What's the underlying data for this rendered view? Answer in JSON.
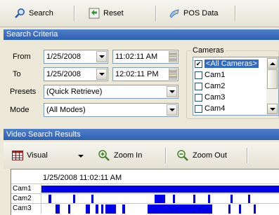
{
  "toolbar": {
    "search_label": "Search",
    "reset_label": "Reset",
    "pos_label": "POS Data"
  },
  "search_criteria": {
    "header": "Search Criteria",
    "from_label": "From",
    "from_date": "1/25/2008",
    "from_time": "11:02:11 AM",
    "to_label": "To",
    "to_date": "1/25/2008",
    "to_time": "12:02:11 PM",
    "presets_label": "Presets",
    "presets_value": "(Quick Retrieve)",
    "mode_label": "Mode",
    "mode_value": "(All Modes)"
  },
  "cameras": {
    "title": "Cameras",
    "items": [
      {
        "label": "<All Cameras>",
        "checked": true
      },
      {
        "label": "Cam1",
        "checked": false
      },
      {
        "label": "Cam2",
        "checked": false
      },
      {
        "label": "Cam3",
        "checked": false
      },
      {
        "label": "Cam4",
        "checked": false
      }
    ]
  },
  "results": {
    "header": "Video Search Results",
    "visual_label": "Visual",
    "zoom_in_label": "Zoom In",
    "zoom_out_label": "Zoom Out",
    "timeline_start": "1/25/2008 11:02:11 AM",
    "rows": [
      {
        "camera": "Cam1",
        "segments": [
          [
            0.0,
            1.0
          ]
        ]
      },
      {
        "camera": "Cam2",
        "segments": [
          [
            0.03,
            0.043
          ],
          [
            0.133,
            0.143
          ],
          [
            0.21,
            0.22
          ],
          [
            0.475,
            0.52
          ],
          [
            0.552,
            0.562
          ],
          [
            0.638,
            0.648
          ],
          [
            0.7,
            0.71
          ],
          [
            0.795,
            0.805
          ],
          [
            0.87,
            0.88
          ]
        ]
      },
      {
        "camera": "Cam3",
        "segments": [
          [
            0.06,
            0.078
          ],
          [
            0.113,
            0.122
          ],
          [
            0.186,
            0.204
          ],
          [
            0.228,
            0.24
          ],
          [
            0.251,
            0.26
          ],
          [
            0.27,
            0.315
          ],
          [
            0.339,
            0.35
          ],
          [
            0.447,
            0.72
          ],
          [
            0.788,
            0.797
          ],
          [
            0.832,
            0.84
          ],
          [
            0.893,
            0.902
          ]
        ]
      }
    ]
  },
  "colors": {
    "header_blue": "#2e5fb2",
    "segment_blue": "#0000e8",
    "selection_blue": "#316ac5"
  }
}
